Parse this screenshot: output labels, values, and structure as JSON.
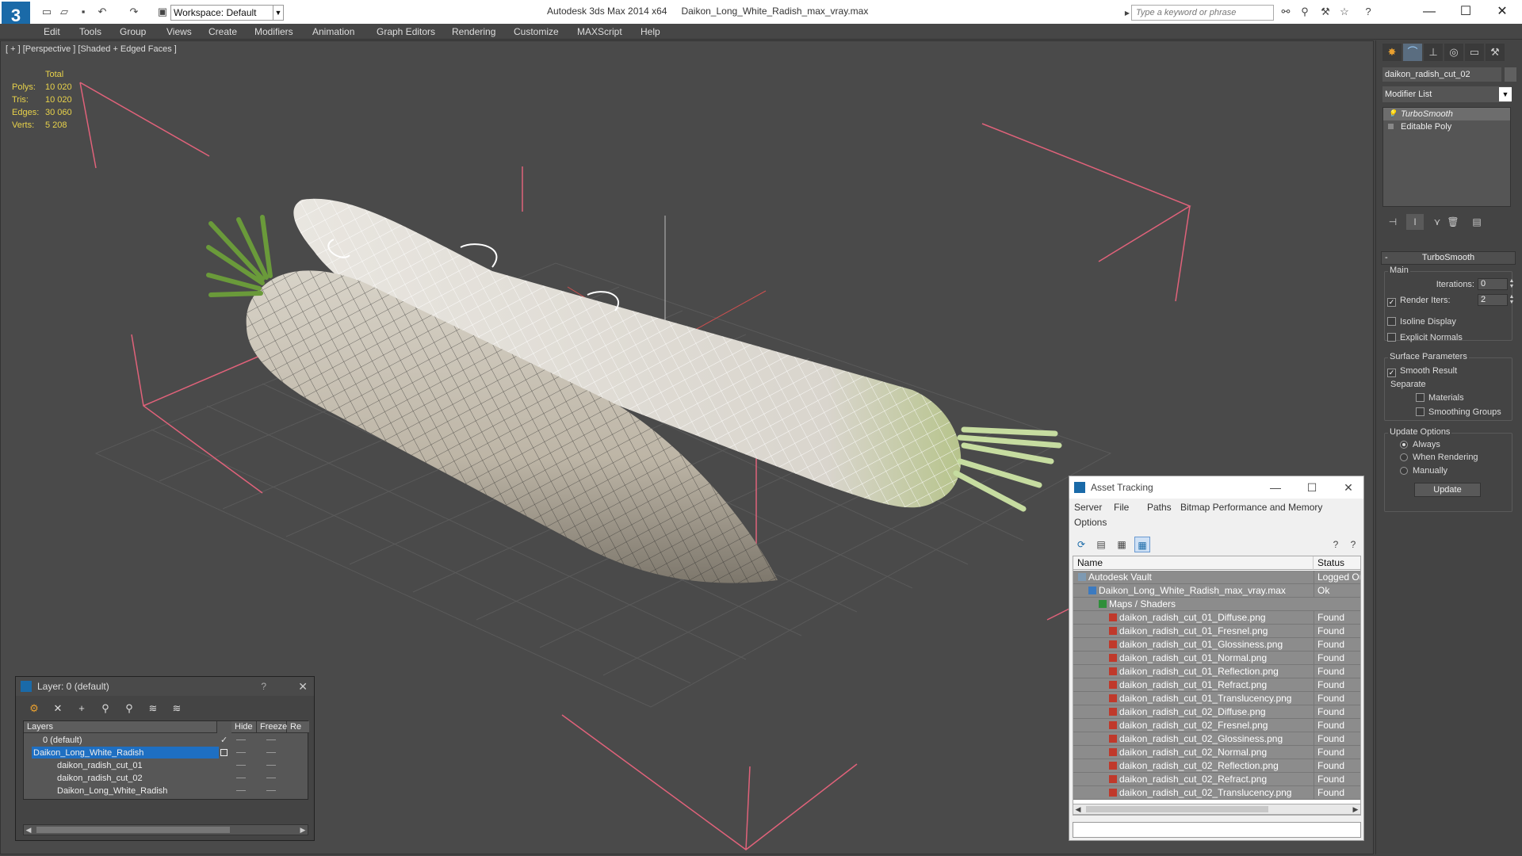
{
  "title_bar": {
    "app_name": "Autodesk 3ds Max  2014 x64",
    "file_name": "Daikon_Long_White_Radish_max_vray.max",
    "workspace": "Workspace: Default",
    "search_placeholder": "Type a keyword or phrase"
  },
  "menu": [
    "Edit",
    "Tools",
    "Group",
    "Views",
    "Create",
    "Modifiers",
    "Animation",
    "Graph Editors",
    "Rendering",
    "Customize",
    "MAXScript",
    "Help"
  ],
  "viewport": {
    "label": "[ + ] [Perspective ] [Shaded + Edged Faces ]",
    "stats_header": "Total",
    "stats": [
      {
        "label": "Polys:",
        "value": "10 020"
      },
      {
        "label": "Tris:",
        "value": "10 020"
      },
      {
        "label": "Edges:",
        "value": "30 060"
      },
      {
        "label": "Verts:",
        "value": "5 208"
      }
    ]
  },
  "command_panel": {
    "object_name": "daikon_radish_cut_02",
    "modifier_list": "Modifier List",
    "stack": [
      "TurboSmooth",
      "Editable Poly"
    ],
    "rollout_title": "TurboSmooth",
    "main_group": "Main",
    "iterations_label": "Iterations:",
    "iterations_value": "0",
    "render_iters_label": "Render Iters:",
    "render_iters_value": "2",
    "isoline_display": "Isoline Display",
    "explicit_normals": "Explicit Normals",
    "surface_params": "Surface Parameters",
    "smooth_result": "Smooth Result",
    "separate": "Separate",
    "materials": "Materials",
    "smoothing_groups": "Smoothing Groups",
    "update_options": "Update Options",
    "always": "Always",
    "when_rendering": "When Rendering",
    "manually": "Manually",
    "update_button": "Update"
  },
  "layer_dialog": {
    "title": "Layer: 0 (default)",
    "help": "?",
    "columns": [
      "Layers",
      "Hide",
      "Freeze",
      "Re"
    ],
    "rows": [
      {
        "name": "0 (default)",
        "indent": 1
      },
      {
        "name": "Daikon_Long_White_Radish",
        "indent": 0
      },
      {
        "name": "daikon_radish_cut_01",
        "indent": 2
      },
      {
        "name": "daikon_radish_cut_02",
        "indent": 2
      },
      {
        "name": "Daikon_Long_White_Radish",
        "indent": 2
      }
    ]
  },
  "asset_tracking": {
    "title": "Asset Tracking",
    "menu": [
      "Server",
      "File",
      "Paths",
      "Bitmap Performance and Memory",
      "Options"
    ],
    "columns": [
      "Name",
      "Status"
    ],
    "rows": [
      {
        "name": "Autodesk Vault",
        "status": "Logged Ou",
        "type": "vault",
        "indent": 0
      },
      {
        "name": "Daikon_Long_White_Radish_max_vray.max",
        "status": "Ok",
        "type": "max",
        "indent": 1
      },
      {
        "name": "Maps / Shaders",
        "status": "",
        "type": "maps",
        "indent": 2
      },
      {
        "name": "daikon_radish_cut_01_Diffuse.png",
        "status": "Found",
        "type": "png",
        "indent": 3
      },
      {
        "name": "daikon_radish_cut_01_Fresnel.png",
        "status": "Found",
        "type": "png",
        "indent": 3
      },
      {
        "name": "daikon_radish_cut_01_Glossiness.png",
        "status": "Found",
        "type": "png",
        "indent": 3
      },
      {
        "name": "daikon_radish_cut_01_Normal.png",
        "status": "Found",
        "type": "png",
        "indent": 3
      },
      {
        "name": "daikon_radish_cut_01_Reflection.png",
        "status": "Found",
        "type": "png",
        "indent": 3
      },
      {
        "name": "daikon_radish_cut_01_Refract.png",
        "status": "Found",
        "type": "png",
        "indent": 3
      },
      {
        "name": "daikon_radish_cut_01_Translucency.png",
        "status": "Found",
        "type": "png",
        "indent": 3
      },
      {
        "name": "daikon_radish_cut_02_Diffuse.png",
        "status": "Found",
        "type": "png",
        "indent": 3
      },
      {
        "name": "daikon_radish_cut_02_Fresnel.png",
        "status": "Found",
        "type": "png",
        "indent": 3
      },
      {
        "name": "daikon_radish_cut_02_Glossiness.png",
        "status": "Found",
        "type": "png",
        "indent": 3
      },
      {
        "name": "daikon_radish_cut_02_Normal.png",
        "status": "Found",
        "type": "png",
        "indent": 3
      },
      {
        "name": "daikon_radish_cut_02_Reflection.png",
        "status": "Found",
        "type": "png",
        "indent": 3
      },
      {
        "name": "daikon_radish_cut_02_Refract.png",
        "status": "Found",
        "type": "png",
        "indent": 3
      },
      {
        "name": "daikon_radish_cut_02_Translucency.png",
        "status": "Found",
        "type": "png",
        "indent": 3
      }
    ]
  },
  "colors": {
    "stats_text": "#e8d24a",
    "selection_blue": "#1e6fc2",
    "bounding_box": "#e0627a",
    "wireframe": "#ffffff",
    "app_blue": "#1a6aa8"
  }
}
